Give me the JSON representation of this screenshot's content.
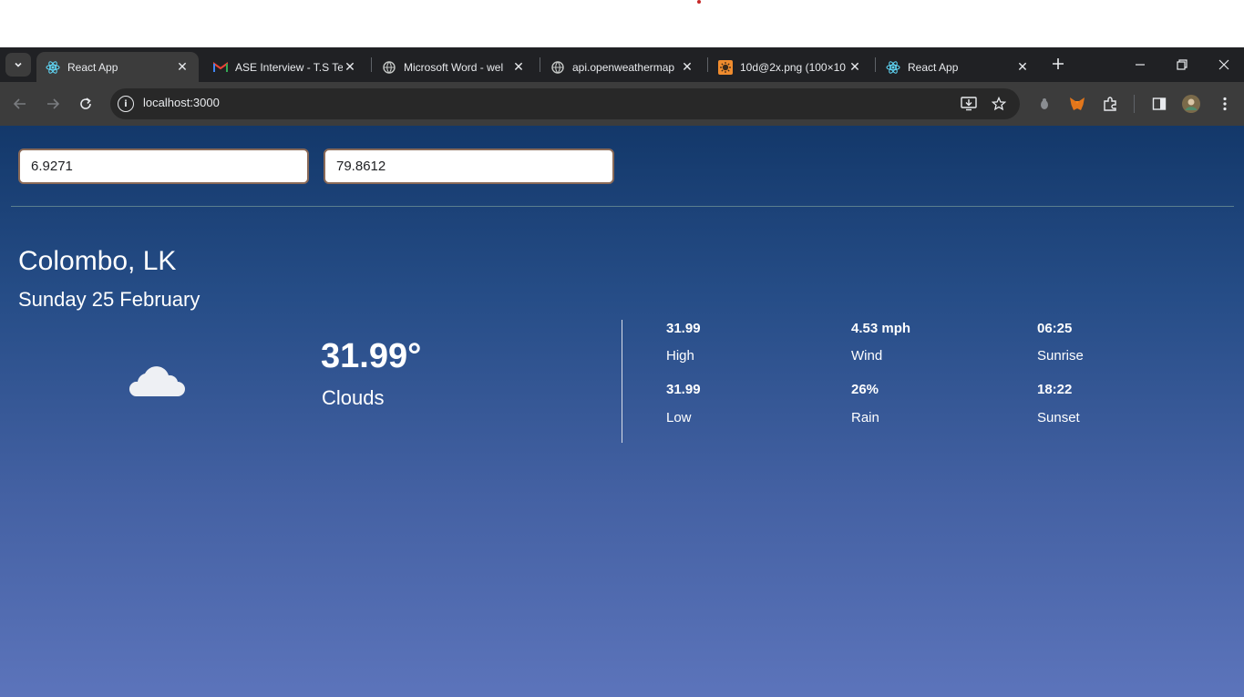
{
  "browser": {
    "tabs": [
      {
        "title": "React App",
        "icon": "react-icon",
        "active": true
      },
      {
        "title": "ASE Interview - T.S Te",
        "icon": "gmail-icon",
        "active": false
      },
      {
        "title": "Microsoft Word - wel",
        "icon": "globe-icon",
        "active": false
      },
      {
        "title": "api.openweathermap",
        "icon": "globe-icon",
        "active": false
      },
      {
        "title": "10d@2x.png (100×10",
        "icon": "sun-image-icon",
        "active": false
      },
      {
        "title": "React App",
        "icon": "react-icon",
        "active": false
      }
    ],
    "url": "localhost:3000"
  },
  "search": {
    "latitude": "6.9271",
    "longitude": "79.8612"
  },
  "weather": {
    "location": "Colombo, LK",
    "date": "Sunday 25 February",
    "temperature": "31.99°",
    "description": "Clouds",
    "icon": "cloud-icon",
    "stats": [
      {
        "value": "31.99",
        "label": "High"
      },
      {
        "value": "4.53 mph",
        "label": "Wind"
      },
      {
        "value": "06:25",
        "label": "Sunrise"
      },
      {
        "value": "31.99",
        "label": "Low"
      },
      {
        "value": "26%",
        "label": "Rain"
      },
      {
        "value": "18:22",
        "label": "Sunset"
      }
    ]
  },
  "colors": {
    "gradient_top": "#13386a",
    "gradient_bottom": "#5c74bb",
    "input_border": "#8a6a58",
    "chrome_dark": "#202124"
  }
}
